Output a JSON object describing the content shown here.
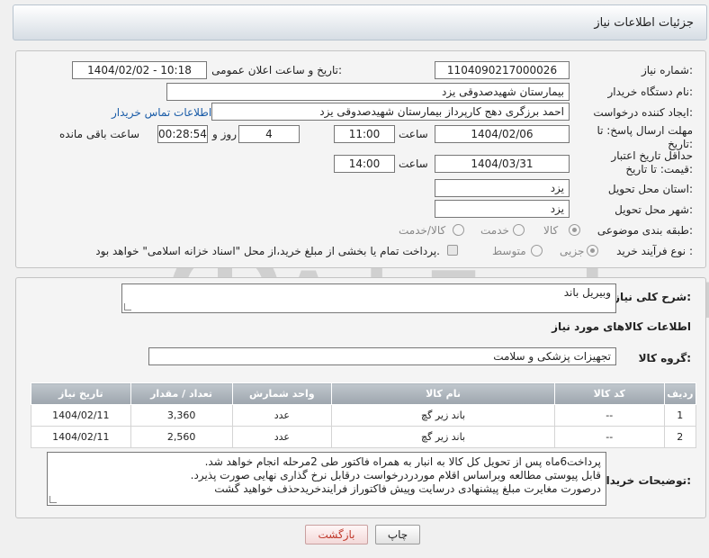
{
  "header": {
    "title": "جزئیات اطلاعات نیاز"
  },
  "form": {
    "need_number_label": "شماره نیاز:",
    "need_number": "1104090217000026",
    "announce_label": "تاریخ و ساعت اعلان عمومی:",
    "announce_value": "1404/02/02 - 10:18",
    "buyer_org_label": "نام دستگاه خریدار:",
    "buyer_org": "بیمارستان شهیدصدوقی یزد",
    "creator_label": "ایجاد کننده درخواست:",
    "creator": "احمد برزگری دهج کارپرداز بیمارستان شهیدصدوقی یزد",
    "contact_link": "اطلاعات تماس خریدار",
    "deadline_label": "مهلت ارسال پاسخ: تا تاریخ:",
    "deadline_date": "1404/02/06",
    "time_label": "ساعت",
    "deadline_time": "11:00",
    "days_value": "4",
    "days_label": "روز و",
    "remaining_time": "00:28:54",
    "remaining_label": "ساعت باقی مانده",
    "validity_label": "حداقل تاریخ اعتبار قیمت: تا تاریخ:",
    "validity_date": "1404/03/31",
    "validity_time": "14:00",
    "province_label": "استان محل تحویل:",
    "province": "یزد",
    "city_label": "شهر محل تحویل:",
    "city": "یزد",
    "category_label": "طبقه بندی موضوعی:",
    "category_options": [
      "کالا",
      "خدمت",
      "کالا/خدمت"
    ],
    "category_selected": "کالا",
    "process_label": "نوع فرآیند خرید :",
    "process_options": [
      "جزیی",
      "متوسط"
    ],
    "process_selected": "جزیی",
    "treasury_note": "پرداخت تمام یا بخشی از مبلغ خرید،از محل \"اسناد خزانه اسلامی\" خواهد بود."
  },
  "details": {
    "summary_label": "شرح کلی نیاز:",
    "summary": "وبیریل باند",
    "goods_info_title": "اطلاعات کالاهای مورد نیاز",
    "group_label": "گروه کالا:",
    "group": "تجهیزات پزشکی و سلامت"
  },
  "table": {
    "headers": [
      "ردیف",
      "کد کالا",
      "نام کالا",
      "واحد شمارش",
      "تعداد / مقدار",
      "تاریخ نیاز"
    ],
    "rows": [
      [
        "1",
        "--",
        "باند زیر گچ",
        "عدد",
        "3,360",
        "1404/02/11"
      ],
      [
        "2",
        "--",
        "باند زیر گچ",
        "عدد",
        "2,560",
        "1404/02/11"
      ]
    ]
  },
  "buyer_notes": {
    "label": "توضیحات خریدار:",
    "lines": [
      "پرداخت6ماه پس از تحویل کل کالا به انبار به همراه فاکتور طی 2مرحله انجام خواهد شد.",
      "قابل پیوستی مطالعه وبراساس اقلام موردردرخواست درقابل نرخ گذاری نهایی  صورت پذیرد.",
      "درصورت مغایرت مبلغ پیشنهادی درسایت وپیش فاکتوراز فرایندخریدحذف خواهید گشت"
    ]
  },
  "buttons": {
    "print": "چاپ",
    "back": "بازگشت"
  },
  "watermark": {
    "text": "AriaTender.net"
  },
  "colors": {
    "link": "#1a5ca8",
    "table_header": "#a8b0b8",
    "back_button_text": "#c0392b"
  }
}
